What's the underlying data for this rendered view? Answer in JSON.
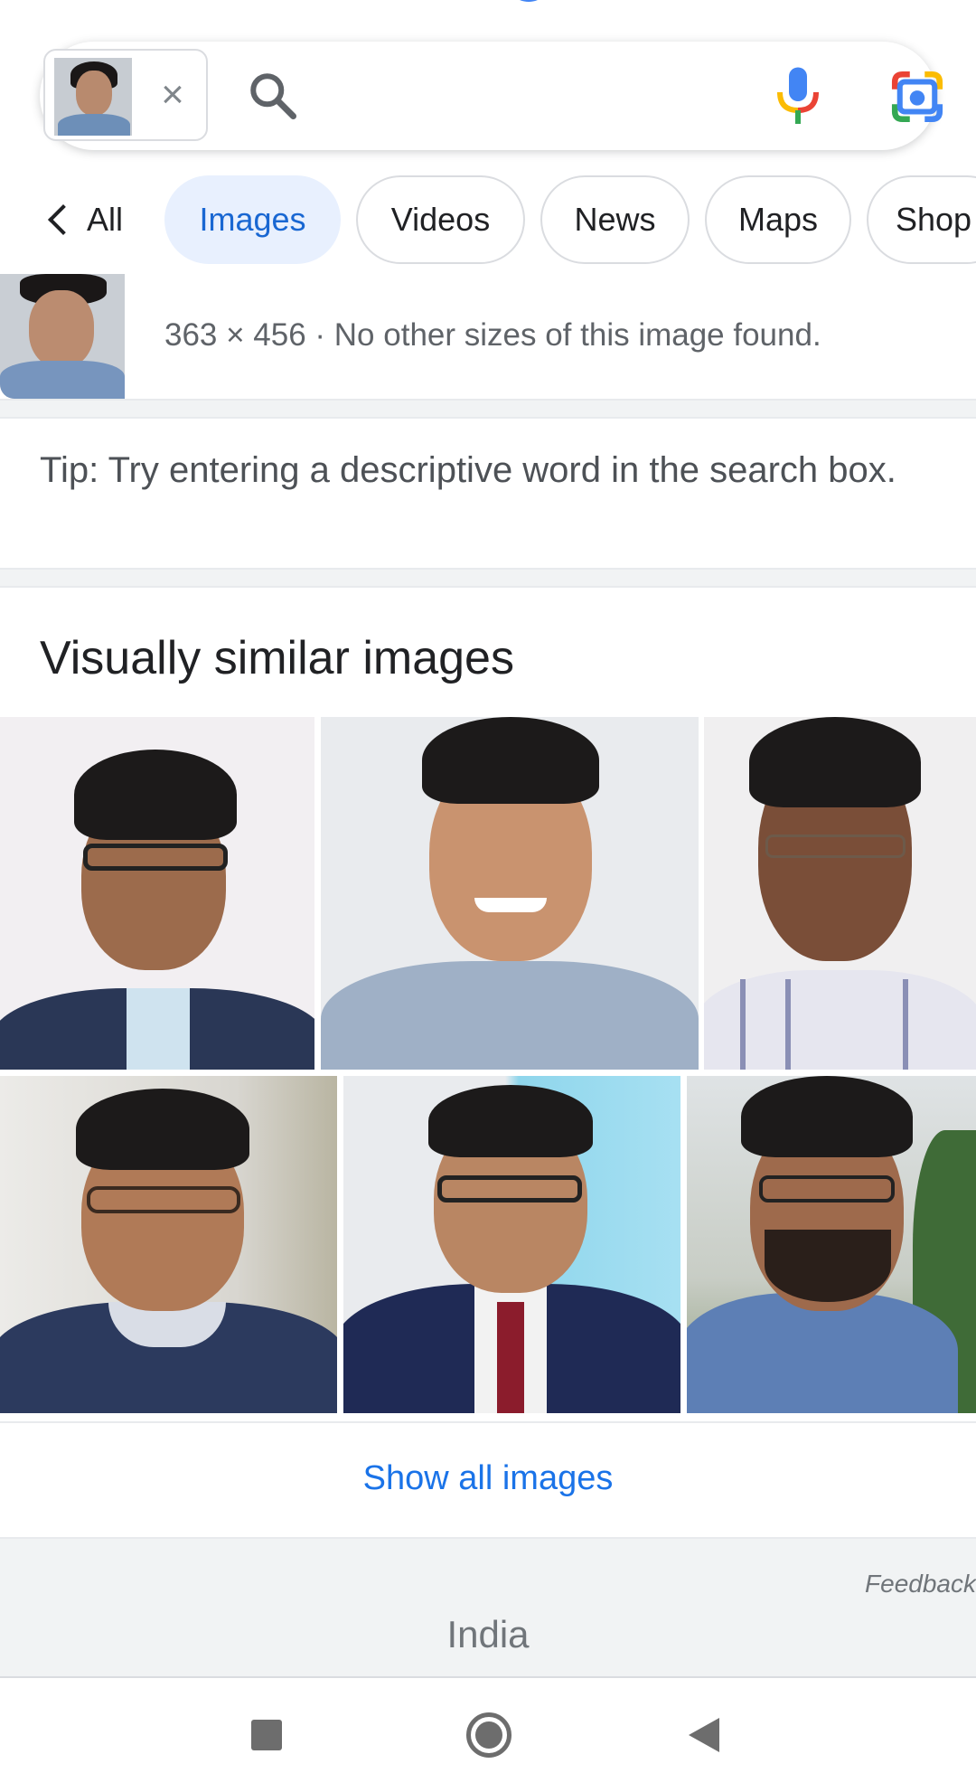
{
  "search": {
    "query_image_alt": "query image",
    "clear_symbol": "×",
    "icons": {
      "search": "search-icon",
      "mic": "mic-icon",
      "lens": "google-lens-icon"
    }
  },
  "tabs": {
    "back_label": "All",
    "items": [
      {
        "label": "Images",
        "active": true
      },
      {
        "label": "Videos",
        "active": false
      },
      {
        "label": "News",
        "active": false
      },
      {
        "label": "Maps",
        "active": false
      },
      {
        "label": "Shop",
        "active": false
      }
    ]
  },
  "image_info": {
    "text": "363 × 456 · No other sizes of this image found."
  },
  "tip": {
    "text": "Tip: Try entering a descriptive word in the search box."
  },
  "similar": {
    "title": "Visually similar images",
    "images": [
      {
        "name": "similar-image-1"
      },
      {
        "name": "similar-image-2"
      },
      {
        "name": "similar-image-3"
      },
      {
        "name": "similar-image-4"
      },
      {
        "name": "similar-image-5"
      },
      {
        "name": "similar-image-6"
      }
    ],
    "show_all_label": "Show all images"
  },
  "footer": {
    "feedback": "Feedback",
    "country": "India"
  },
  "colors": {
    "accent": "#1a73e8",
    "active_tab_bg": "#e8f0fe",
    "footer_bg": "#f1f3f4"
  }
}
